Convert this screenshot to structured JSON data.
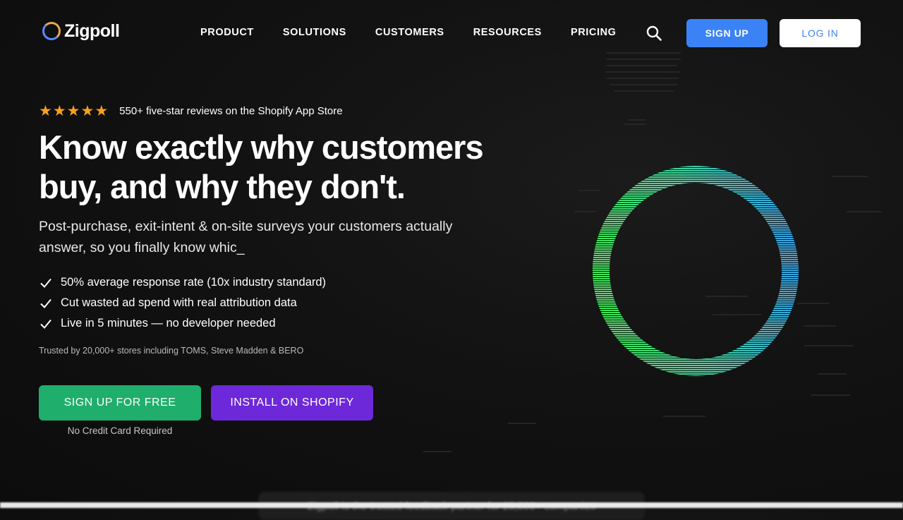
{
  "brand": {
    "name": "Zigpoll"
  },
  "nav": {
    "links": [
      "PRODUCT",
      "SOLUTIONS",
      "CUSTOMERS",
      "RESOURCES",
      "PRICING"
    ],
    "search_icon": "search-icon",
    "signup_label": "SIGN UP",
    "login_label": "LOG IN"
  },
  "hero": {
    "rating_stars": 5,
    "rating_text": "550+ five-star reviews on the Shopify App Store",
    "headline": "Know exactly why customers buy, and why they don't.",
    "subhead": "Post-purchase, exit-intent & on-site surveys your customers actually answer, so you finally know whic_",
    "bullets": [
      "50% average response rate (10x industry standard)",
      "Cut wasted ad spend with real attribution data",
      "Live in 5 minutes — no developer needed"
    ],
    "trusted": "Trusted by 20,000+ stores including TOMS, Steve Madden & BERO",
    "cta_primary": "SIGN UP FOR FREE",
    "cta_secondary": "INSTALL ON SHOPIFY",
    "cta_note": "No Credit Card Required"
  },
  "banner": {
    "text": "Zigpoll is the trusted feedback partner for 20,000+ companies"
  },
  "colors": {
    "accent_blue": "#3b82f6",
    "cta_green": "#1fae6b",
    "cta_purple": "#6d28d9",
    "star": "#f6a11d",
    "ring_green": "#3fe06a",
    "ring_blue": "#3aa6d8"
  }
}
